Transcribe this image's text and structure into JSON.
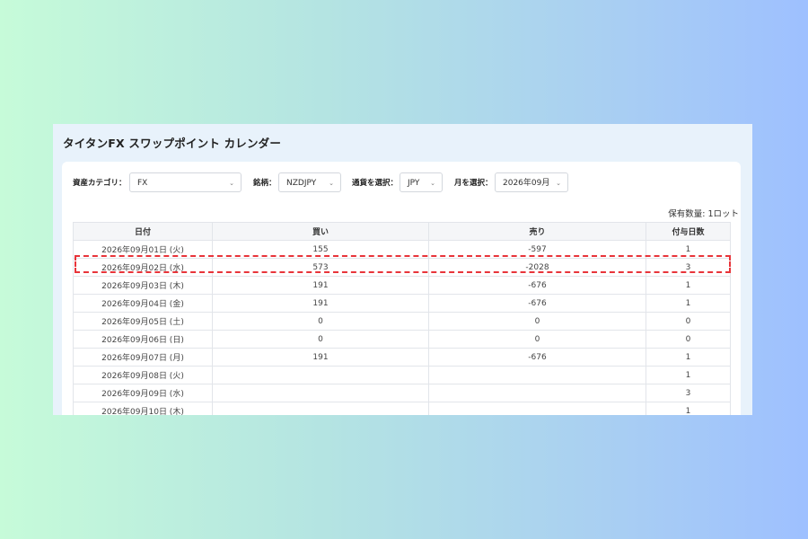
{
  "page": {
    "title": "タイタンFX スワップポイント カレンダー"
  },
  "filters": {
    "category_label": "資産カテゴリ：",
    "category_value": "FX",
    "symbol_label": "銘柄：",
    "symbol_value": "NZDJPY",
    "currency_label": "通貨を選択：",
    "currency_value": "JPY",
    "month_label": "月を選択：",
    "month_value": "2026年09月",
    "chevron": "⌄"
  },
  "holding": "保有数量: 1ロット",
  "table": {
    "headers": [
      "日付",
      "買い",
      "売り",
      "付与日数"
    ],
    "rows": [
      [
        "2026年09月01日 (火)",
        "155",
        "-597",
        "1"
      ],
      [
        "2026年09月02日 (水)",
        "573",
        "-2028",
        "3"
      ],
      [
        "2026年09月03日 (木)",
        "191",
        "-676",
        "1"
      ],
      [
        "2026年09月04日 (金)",
        "191",
        "-676",
        "1"
      ],
      [
        "2026年09月05日 (土)",
        "0",
        "0",
        "0"
      ],
      [
        "2026年09月06日 (日)",
        "0",
        "0",
        "0"
      ],
      [
        "2026年09月07日 (月)",
        "191",
        "-676",
        "1"
      ],
      [
        "2026年09月08日 (火)",
        "",
        "",
        "1"
      ],
      [
        "2026年09月09日 (水)",
        "",
        "",
        "3"
      ],
      [
        "2026年09月10日 (木)",
        "",
        "",
        "1"
      ]
    ]
  },
  "colors": {
    "highlight": "#e8343a",
    "panel_bg": "#e8f2fb"
  }
}
